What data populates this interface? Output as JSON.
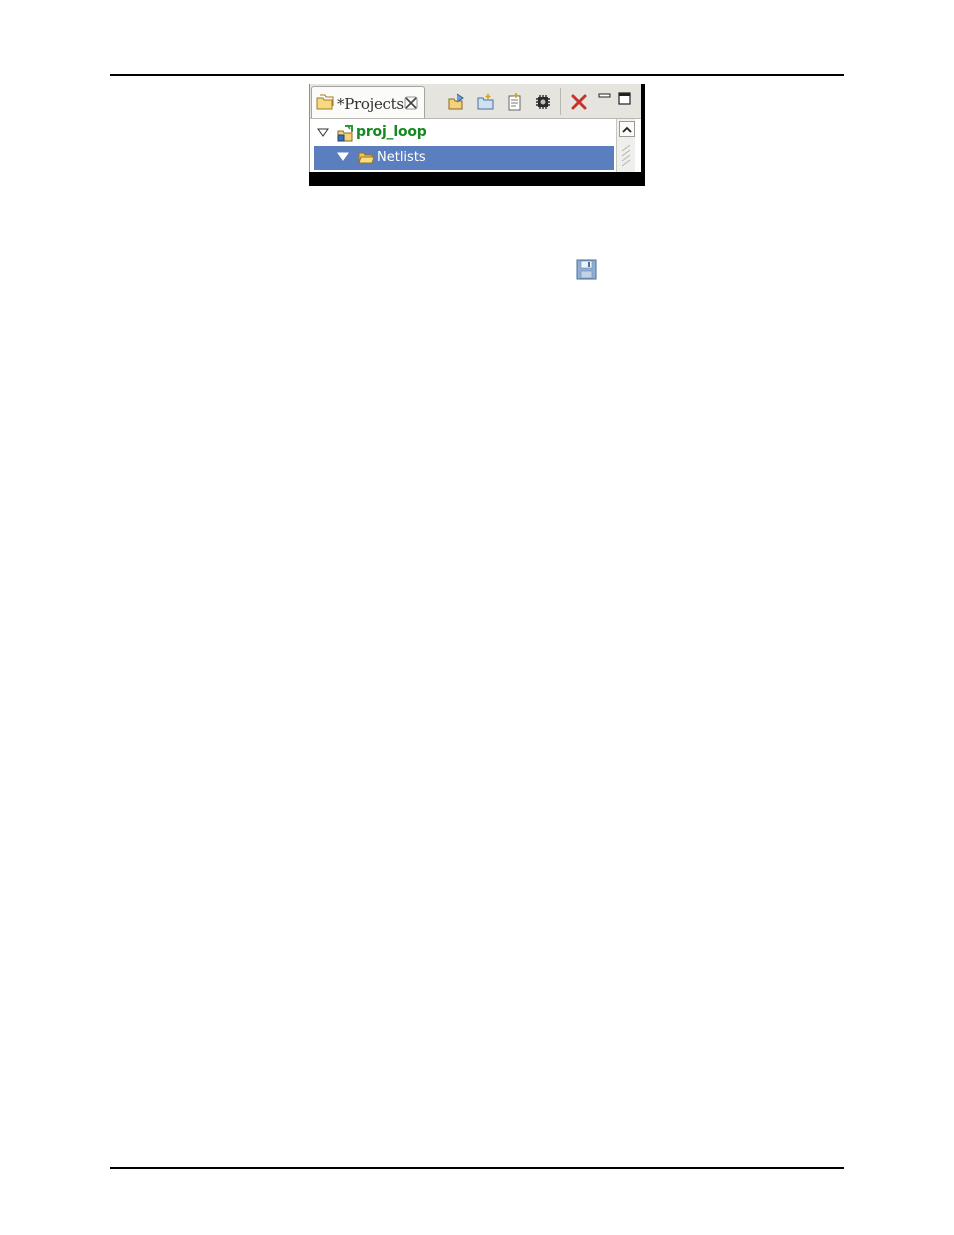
{
  "view": {
    "tab_label": "*Projects",
    "icons": {
      "tab": "projects-folder-icon",
      "close": "close-tab-icon",
      "toolbar": [
        "open-project-icon",
        "new-folder-icon",
        "properties-icon",
        "build-icon",
        "delete-icon",
        "minimize-icon",
        "maximize-icon"
      ]
    },
    "tree": [
      {
        "label": "proj_loop",
        "expanded": true,
        "color": "#14891f"
      },
      {
        "label": "Netlists",
        "expanded": true,
        "selected": true
      }
    ],
    "selection_color": "#5b7fbe"
  },
  "inline_icon": "save-icon"
}
